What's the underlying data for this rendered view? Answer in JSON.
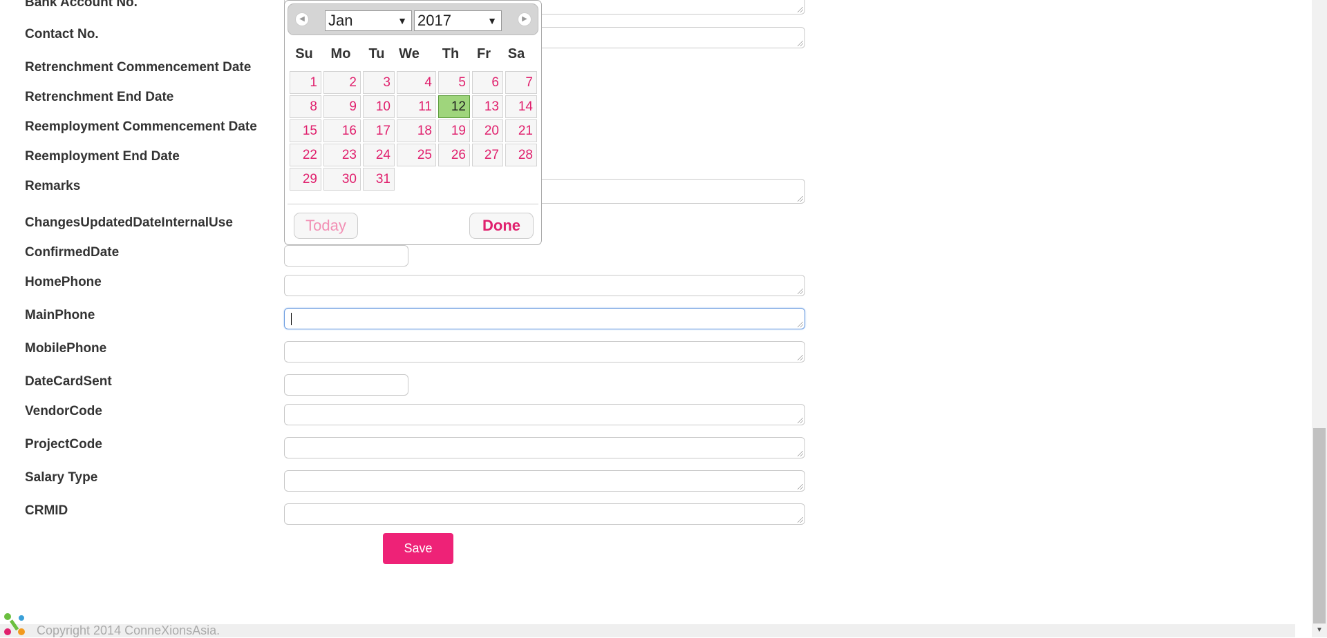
{
  "form": {
    "labels": {
      "bank_account": "Bank Account No.",
      "contact_no": "Contact No.",
      "retrenchment_commencement": "Retrenchment Commencement Date",
      "retrenchment_end": "Retrenchment End Date",
      "reemployment_commencement": "Reemployment Commencement Date",
      "reemployment_end": "Reemployment End Date",
      "remarks": "Remarks",
      "changes_updated": "ChangesUpdatedDateInternalUse",
      "confirmed_date": "ConfirmedDate",
      "home_phone": "HomePhone",
      "main_phone": "MainPhone",
      "mobile_phone": "MobilePhone",
      "date_card_sent": "DateCardSent",
      "vendor_code": "VendorCode",
      "project_code": "ProjectCode",
      "salary_type": "Salary Type",
      "crmid": "CRMID"
    },
    "save_label": "Save"
  },
  "datepicker": {
    "month": "Jan",
    "year": "2017",
    "weekdays": [
      "Su",
      "Mo",
      "Tu",
      "We",
      "Th",
      "Fr",
      "Sa"
    ],
    "days": [
      "1",
      "2",
      "3",
      "4",
      "5",
      "6",
      "7",
      "8",
      "9",
      "10",
      "11",
      "12",
      "13",
      "14",
      "15",
      "16",
      "17",
      "18",
      "19",
      "20",
      "21",
      "22",
      "23",
      "24",
      "25",
      "26",
      "27",
      "28",
      "29",
      "30",
      "31"
    ],
    "selected_day": "12",
    "today_label": "Today",
    "done_label": "Done"
  },
  "footer": {
    "copyright": "Copyright 2014 ConneXionsAsia."
  },
  "colors": {
    "accent": "#ee2277",
    "day_text": "#e0206d",
    "selected_day_bg": "#9fd57c"
  }
}
